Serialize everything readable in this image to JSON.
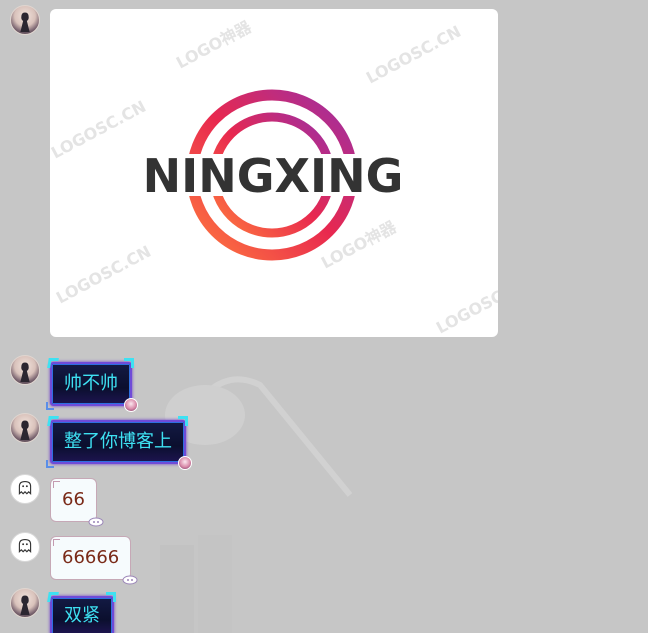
{
  "image_message": {
    "logo_text": "NINGXING",
    "watermark": "LOGOSC.CN",
    "watermark_alt": "LOGO神器"
  },
  "messages": [
    {
      "sender": "girl-avatar",
      "style": "neon",
      "text": "帅不帅"
    },
    {
      "sender": "girl-avatar",
      "style": "neon",
      "text": "整了你博客上"
    },
    {
      "sender": "ghost-avatar",
      "style": "light",
      "text": "66"
    },
    {
      "sender": "ghost-avatar",
      "style": "light",
      "text": "66666"
    },
    {
      "sender": "girl-avatar",
      "style": "neon",
      "text": "双紧"
    }
  ],
  "colors": {
    "background": "#c6c6c6",
    "neon_text": "#3ee1f2",
    "light_text": "#7a2a18",
    "logo_text": "#333333",
    "logo_ring_start": "#ff7a3d",
    "logo_ring_end": "#9b2fa6"
  }
}
